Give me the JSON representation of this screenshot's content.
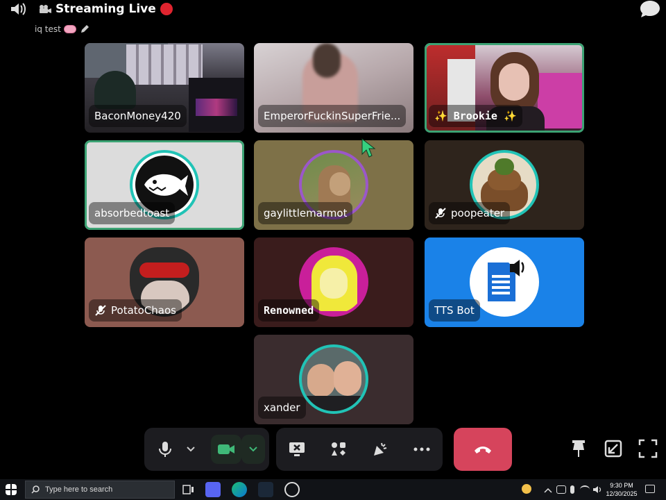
{
  "header": {
    "title": "Streaming Live",
    "subtitle": "iq test"
  },
  "tiles": [
    {
      "name": "BaconMoney420",
      "type": "video",
      "muted": false
    },
    {
      "name": "EmperorFuckinSuperFrie...",
      "type": "video",
      "muted": false
    },
    {
      "name": "✨ Brookie ✨",
      "type": "video",
      "muted": false,
      "speaking": true
    },
    {
      "name": "absorbedtoast",
      "type": "avatar",
      "muted": false,
      "speaking": true
    },
    {
      "name": "gaylittlemarmot",
      "type": "avatar",
      "muted": false
    },
    {
      "name": "poopeater",
      "type": "avatar",
      "muted": true
    },
    {
      "name": "PotatoChaos",
      "type": "avatar",
      "muted": true
    },
    {
      "name": "Renowned",
      "type": "avatar",
      "muted": false
    },
    {
      "name": "TTS Bot",
      "type": "avatar",
      "muted": false
    },
    {
      "name": "xander",
      "type": "avatar",
      "muted": false
    }
  ],
  "controls": {
    "mic": "microphone-icon",
    "camera": "camera-icon",
    "screen_share": "screen-share-icon",
    "activities": "activities-icon",
    "soundboard": "soundboard-icon",
    "more": "more-icon",
    "disconnect": "phone-hangup-icon"
  },
  "taskbar": {
    "search_placeholder": "Type here to search",
    "time": "9:30 PM",
    "date": "12/30/2025"
  },
  "colors": {
    "speaking_ring": "#3ca374",
    "hang_up": "#d6445c",
    "tts_bg": "#1a82e8",
    "live": "#e0242f"
  }
}
